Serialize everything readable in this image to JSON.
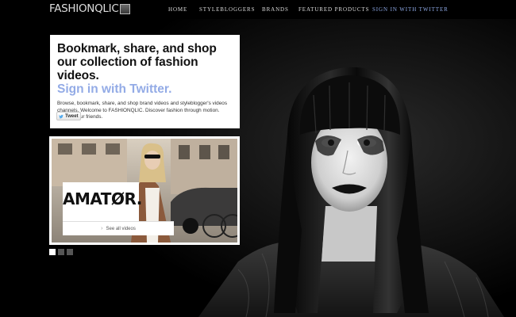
{
  "logo": {
    "text": "FASHIONQLIC"
  },
  "nav": {
    "items": [
      {
        "label": "HOME"
      },
      {
        "label": "STYLEBLOGGERS"
      },
      {
        "label": "BRANDS"
      },
      {
        "label": "FEATURED PRODUCTS"
      }
    ],
    "twitter_label": "SIGN IN WITH TWITTER"
  },
  "intro": {
    "heading": "Bookmark, share, and shop our collection of fashion videos.",
    "signin_label": "Sign in with Twitter.",
    "description": "Browse, bookmark, share, and shop brand videos and styleblogger's videos channels. Welcome to FASHIONQLIC. Discover fashion through motion. Involve your friends.",
    "tweet_label": "Tweet"
  },
  "featured": {
    "brand": "AMATØR.",
    "see_all_label": "See all videos"
  },
  "slider": {
    "count": 3,
    "active": 1
  },
  "colors": {
    "accent": "#93abe6",
    "background": "#000000",
    "card": "#ffffff"
  }
}
